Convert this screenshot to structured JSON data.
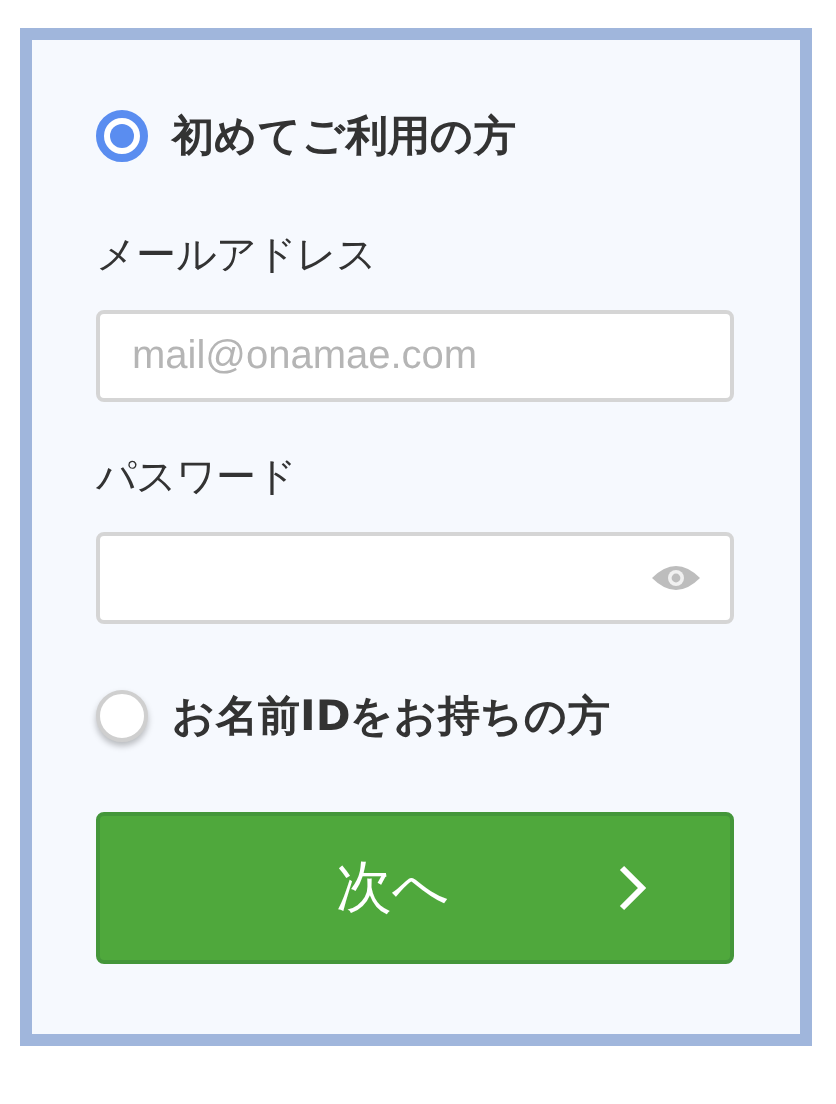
{
  "new_user_option": {
    "label": "初めてご利用の方",
    "selected": true
  },
  "email": {
    "label": "メールアドレス",
    "placeholder": "mail@onamae.com"
  },
  "password": {
    "label": "パスワード"
  },
  "member_option": {
    "label": "お名前IDをお持ちの方",
    "selected": false
  },
  "next_button": {
    "label": "次へ"
  }
}
